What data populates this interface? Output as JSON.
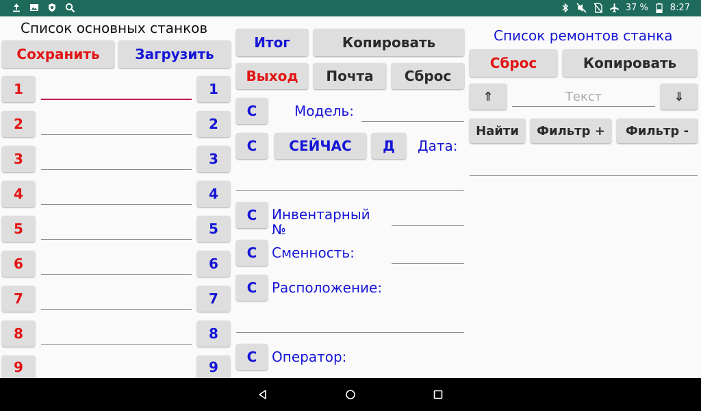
{
  "statusbar": {
    "battery_text": "37 %",
    "time": "8:27",
    "left_icons": [
      "upload-icon",
      "image-icon",
      "shield-icon",
      "search-icon"
    ],
    "right_icons": [
      "bluetooth-icon",
      "mute-icon",
      "no-sim-icon",
      "airplane-icon",
      "battery-icon"
    ]
  },
  "left": {
    "title": "Список основных станков",
    "save_label": "Сохранить",
    "load_label": "Загрузить",
    "rows": [
      {
        "left": "1",
        "right": "1",
        "value": ""
      },
      {
        "left": "2",
        "right": "2",
        "value": ""
      },
      {
        "left": "3",
        "right": "3",
        "value": ""
      },
      {
        "left": "4",
        "right": "4",
        "value": ""
      },
      {
        "left": "5",
        "right": "5",
        "value": ""
      },
      {
        "left": "6",
        "right": "6",
        "value": ""
      },
      {
        "left": "7",
        "right": "7",
        "value": ""
      },
      {
        "left": "8",
        "right": "8",
        "value": ""
      },
      {
        "left": "9",
        "right": "9",
        "value": ""
      }
    ]
  },
  "middle": {
    "total_label": "Итог",
    "copy_label": "Копировать",
    "exit_label": "Выход",
    "mail_label": "Почта",
    "reset_label": "Сброс",
    "c_label": "С",
    "now_label": "СЕЙЧАС",
    "d_label": "Д",
    "model_label": "Модель:",
    "date_label": "Дата:",
    "inventory_label": "Инвентарный №",
    "shift_label": "Сменность:",
    "location_label": "Расположение:",
    "operator_label": "Оператор:",
    "model_value": "",
    "date_value": "",
    "inventory_value": "",
    "shift_value": "",
    "location_value": ""
  },
  "right": {
    "title": "Список ремонтов станка",
    "reset_label": "Сброс",
    "copy_label": "Копировать",
    "up_label": "⇑",
    "down_label": "⇓",
    "search_placeholder": "Текст",
    "find_label": "Найти",
    "filter_plus_label": "Фильтр +",
    "filter_minus_label": "Фильтр -",
    "result_value": ""
  },
  "colors": {
    "statusbar": "#1e6b5c",
    "red_text": "#e21414",
    "blue_text": "#1515d6",
    "active_underline": "#c2185b"
  }
}
